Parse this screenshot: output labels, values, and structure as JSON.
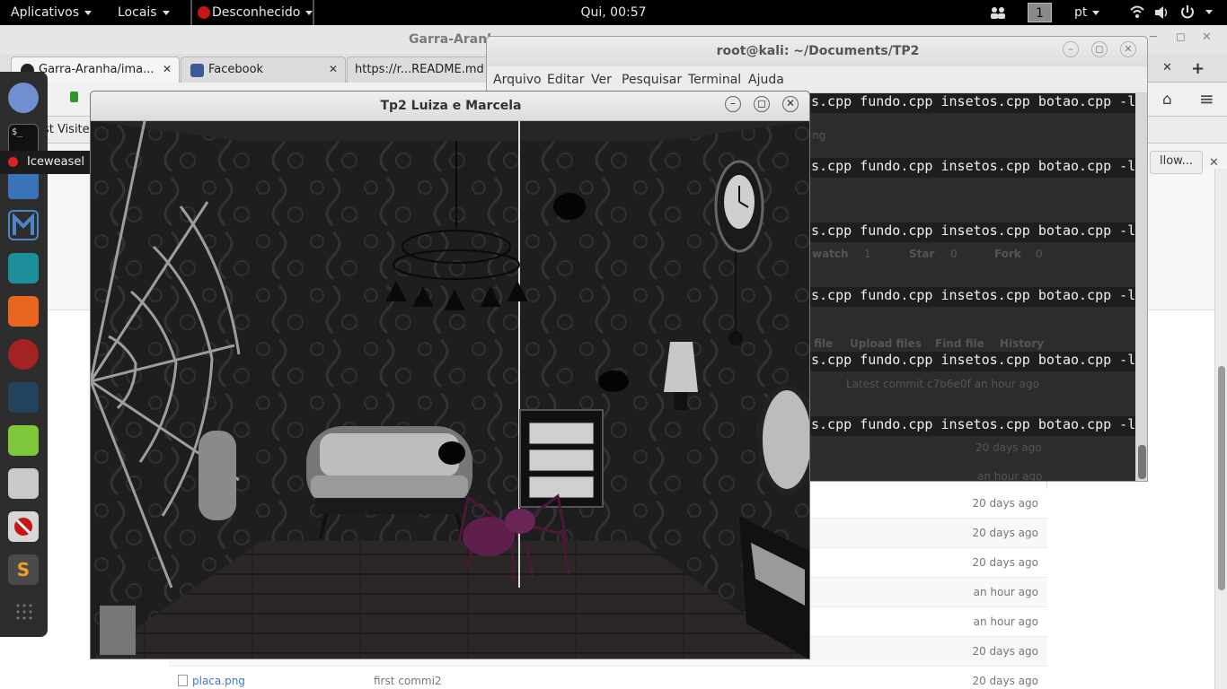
{
  "top_panel": {
    "applications": "Aplicativos",
    "places": "Locais",
    "active_app": "Desconhecido",
    "clock": "Qui, 00:57",
    "workspace": "1",
    "language": "pt",
    "icons": [
      "users-icon",
      "wifi-icon",
      "volume-icon",
      "power-icon"
    ]
  },
  "browser": {
    "window_title": "Garra-Aranha",
    "tabs": [
      {
        "label": "Garra-Aranha/ima...",
        "icon": "github-icon"
      },
      {
        "label": "Facebook",
        "icon": "facebook-icon"
      },
      {
        "label": "https://r...README.md",
        "icon": ""
      }
    ],
    "bookmark_visited": "ost Visited",
    "follow_button": "llow...",
    "files": [
      {
        "age": "20 days ago"
      },
      {
        "age": "20 days ago"
      },
      {
        "age": "20 days ago"
      },
      {
        "age": "an hour ago"
      },
      {
        "age": "an hour ago"
      },
      {
        "age": "20 days ago"
      },
      {
        "name": "placa.png",
        "message": "first commi2",
        "age": "20 days ago"
      }
    ]
  },
  "dock": {
    "tooltip": "Iceweasel",
    "icons": [
      "pidgin-icon",
      "terminal-icon",
      "iceweasel-icon",
      "files-icon",
      "metasploit-icon",
      "armitage-icon",
      "burpsuite-icon",
      "faraday-icon",
      "maltego-icon",
      "text-editor-icon",
      "calculator-icon",
      "recordmydesktop-icon",
      "sublime-text-icon"
    ]
  },
  "terminal": {
    "title": "root@kali: ~/Documents/TP2",
    "menu": [
      "Arquivo",
      "Editar",
      "Ver",
      "Pesquisar",
      "Terminal",
      "Ajuda"
    ],
    "command_fragment": "s.cpp fundo.cpp insetos.cpp botao.cpp -l",
    "line_count": 6,
    "ghost": {
      "ng": "ng",
      "watch": "watch",
      "watch_count": "1",
      "star": "Star",
      "star_count": "0",
      "fork": "Fork",
      "fork_count": "0",
      "file": "file",
      "upload": "Upload files",
      "find": "Find file",
      "history": "History",
      "latest_commit": "Latest commit c7b6e0f an hour ago",
      "age1": "20 days ago",
      "age2": "an hour ago"
    }
  },
  "gl_window": {
    "title": "Tp2 Luiza e Marcela"
  },
  "colors": {
    "panel_bg": "#000000",
    "terminal_bg": "#2c2c2c",
    "spider": "#5e1f4a",
    "link": "#4078c0"
  }
}
